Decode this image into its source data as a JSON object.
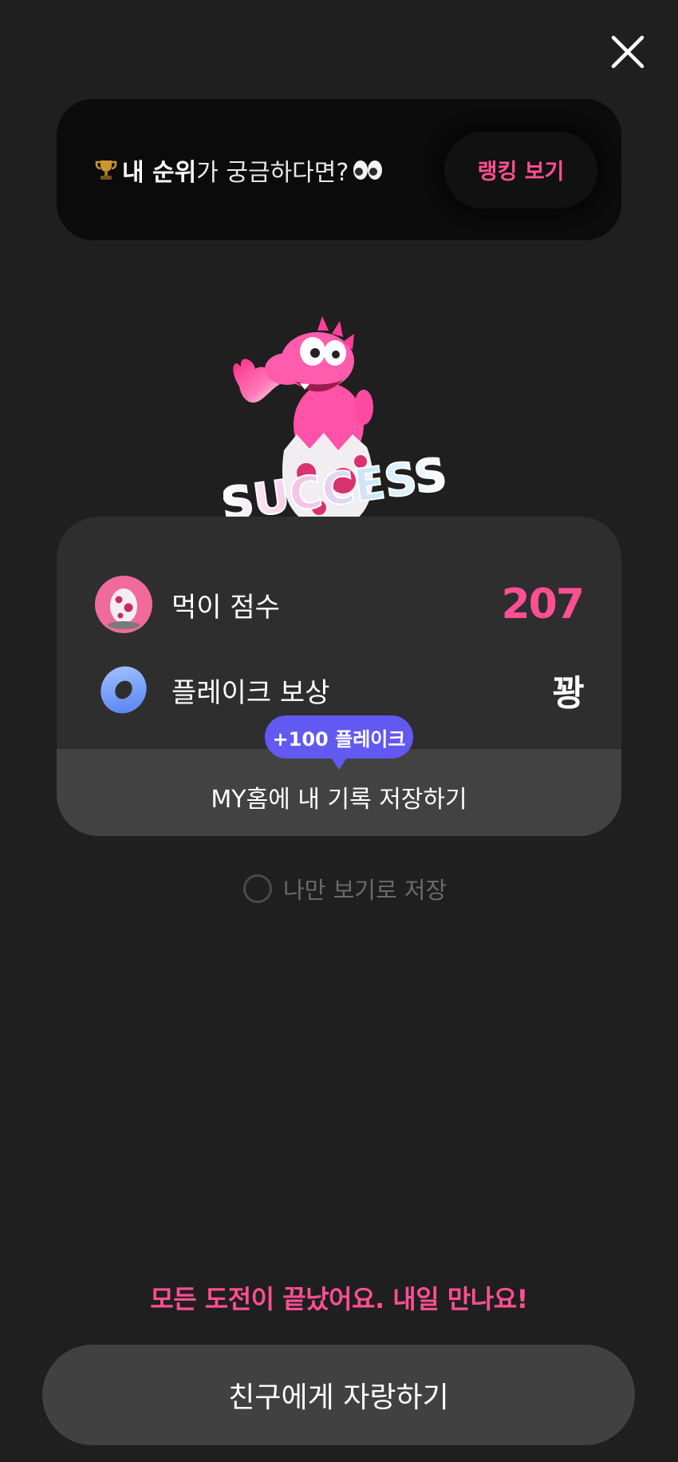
{
  "header": {
    "close_icon": "close-icon"
  },
  "ranking_banner": {
    "trophy_icon": "trophy-icon",
    "text_bold": "내 순위",
    "text_rest": "가 궁금하다면?",
    "eyes_icon": "eyes-icon",
    "button_label": "랭킹 보기"
  },
  "mascot": {
    "label": "SUCCESS"
  },
  "score_card": {
    "rows": [
      {
        "icon": "egg-icon",
        "label": "먹이 점수",
        "value": "207"
      },
      {
        "icon": "donut-icon",
        "label": "플레이크 보상",
        "value": "꽝"
      }
    ],
    "badge": "+100 플레이크",
    "save_label": "MY홈에 내 기록 저장하기"
  },
  "private_save": {
    "label": "나만 보기로 저장",
    "checked": false
  },
  "footer": {
    "message": "모든 도전이 끝났어요. 내일 만나요!",
    "share_label": "친구에게 자랑하기"
  },
  "colors": {
    "background": "#1f1f1f",
    "accent_pink": "#ff4f93",
    "badge_purple": "#6159f2",
    "card": "#2e2e2e"
  }
}
